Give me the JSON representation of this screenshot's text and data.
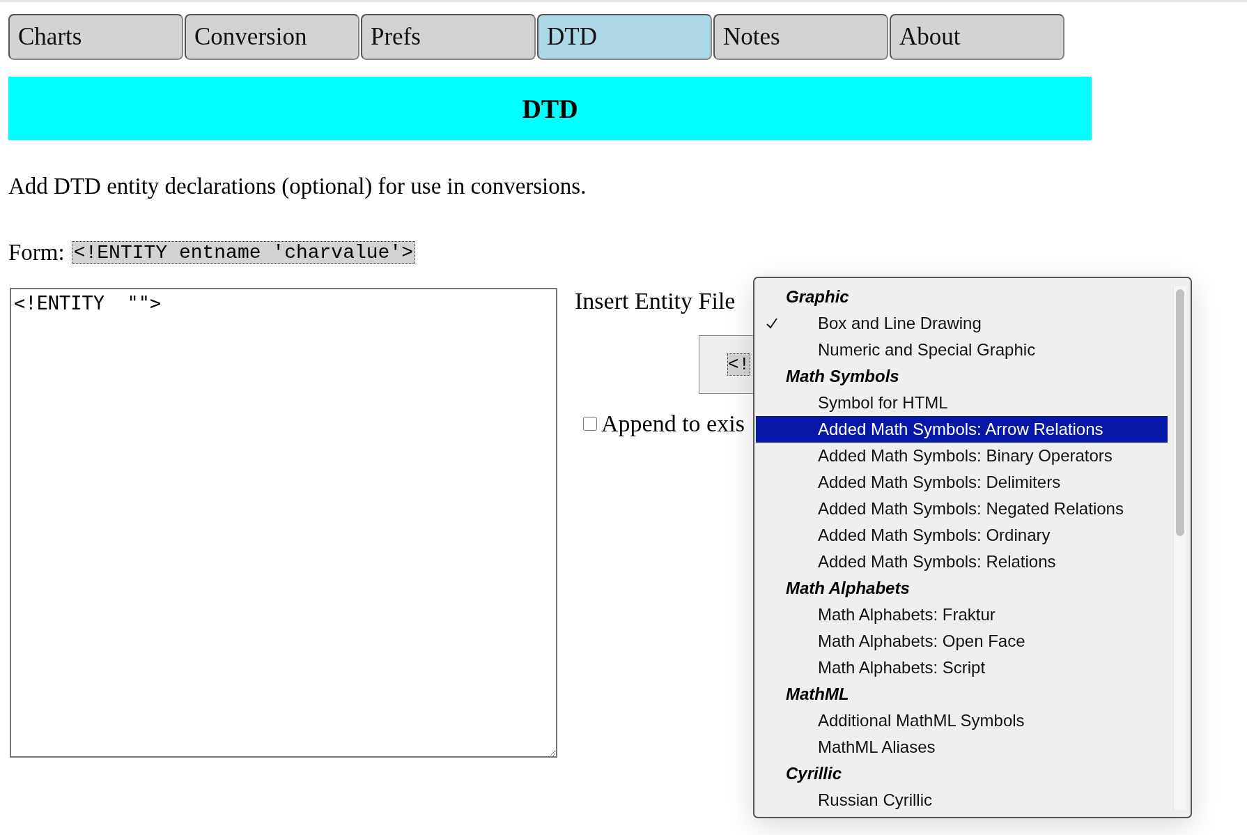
{
  "tabs": [
    {
      "label": "Charts",
      "selected": false
    },
    {
      "label": "Conversion",
      "selected": false
    },
    {
      "label": "Prefs",
      "selected": false
    },
    {
      "label": "DTD",
      "selected": true
    },
    {
      "label": "Notes",
      "selected": false
    },
    {
      "label": "About",
      "selected": false
    }
  ],
  "header": {
    "title": "DTD"
  },
  "intro": "Add DTD entity declarations (optional) for use in conversions.",
  "form": {
    "label": "Form:",
    "code": "<!ENTITY entname 'charvalue'>"
  },
  "editor": {
    "value": "<!ENTITY  \"\">"
  },
  "insert_label": "Insert Entity File",
  "insert_button": {
    "label": "<!"
  },
  "append": {
    "label": "Append to exis",
    "checked": false
  },
  "dropdown": {
    "groups": [
      {
        "label": "Graphic",
        "items": [
          {
            "label": "Box and Line Drawing",
            "checked": true,
            "selected": false
          },
          {
            "label": "Numeric and Special Graphic",
            "checked": false,
            "selected": false
          }
        ]
      },
      {
        "label": "Math Symbols",
        "items": [
          {
            "label": "Symbol for HTML",
            "checked": false,
            "selected": false
          },
          {
            "label": "Added Math Symbols: Arrow Relations",
            "checked": false,
            "selected": true
          },
          {
            "label": "Added Math Symbols: Binary Operators",
            "checked": false,
            "selected": false
          },
          {
            "label": "Added Math Symbols: Delimiters",
            "checked": false,
            "selected": false
          },
          {
            "label": "Added Math Symbols: Negated Relations",
            "checked": false,
            "selected": false
          },
          {
            "label": "Added Math Symbols: Ordinary",
            "checked": false,
            "selected": false
          },
          {
            "label": "Added Math Symbols: Relations",
            "checked": false,
            "selected": false
          }
        ]
      },
      {
        "label": "Math Alphabets",
        "items": [
          {
            "label": "Math Alphabets: Fraktur",
            "checked": false,
            "selected": false
          },
          {
            "label": "Math Alphabets: Open Face",
            "checked": false,
            "selected": false
          },
          {
            "label": "Math Alphabets: Script",
            "checked": false,
            "selected": false
          }
        ]
      },
      {
        "label": "MathML",
        "items": [
          {
            "label": "Additional MathML Symbols",
            "checked": false,
            "selected": false
          },
          {
            "label": "MathML Aliases",
            "checked": false,
            "selected": false
          }
        ]
      },
      {
        "label": "Cyrillic",
        "items": [
          {
            "label": "Russian Cyrillic",
            "checked": false,
            "selected": false
          }
        ]
      }
    ]
  }
}
